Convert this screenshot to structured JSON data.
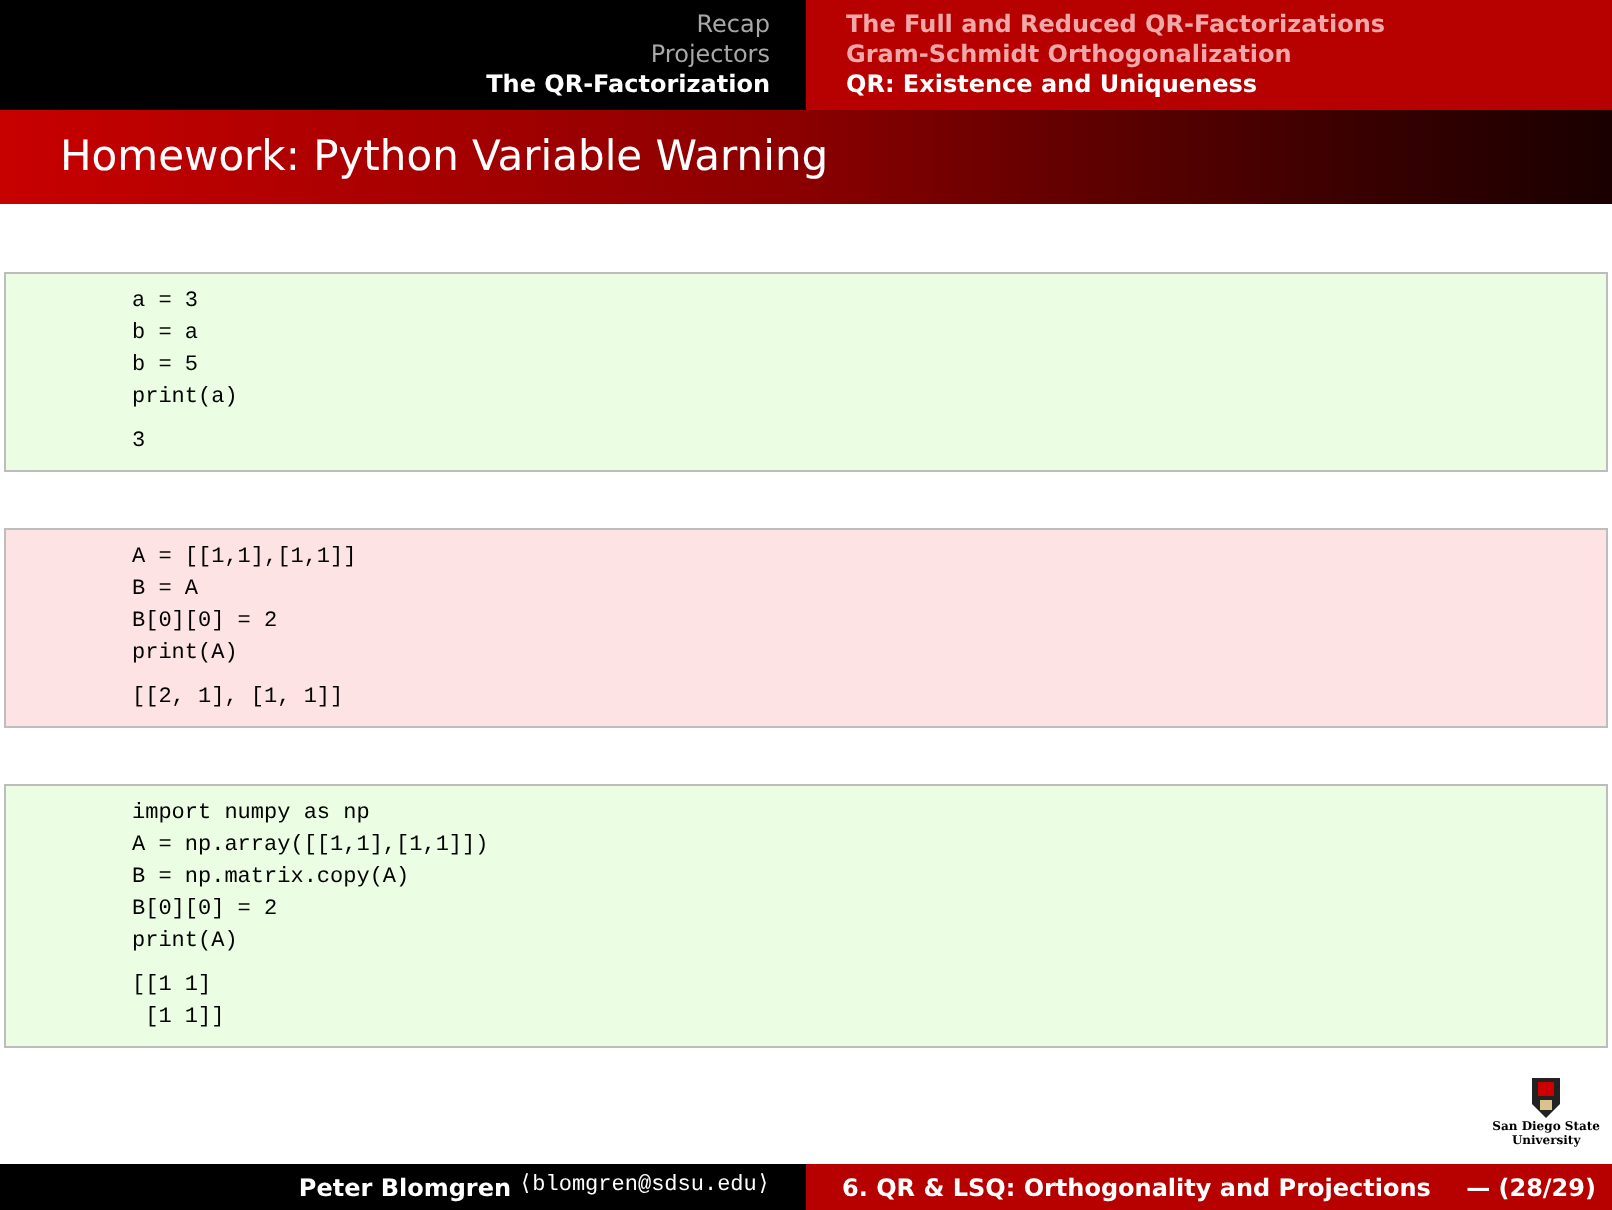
{
  "header": {
    "sections": [
      {
        "label": "Recap",
        "selected": false
      },
      {
        "label": "Projectors",
        "selected": false
      },
      {
        "label": "The QR-Factorization",
        "selected": true
      }
    ],
    "subsections": [
      {
        "label": "The Full and Reduced QR-Factorizations",
        "selected": false
      },
      {
        "label": "Gram-Schmidt Orthogonalization",
        "selected": false
      },
      {
        "label": "QR: Existence and Uniqueness",
        "selected": true
      }
    ]
  },
  "slide_title": "Homework: Python Variable Warning",
  "code_blocks": [
    {
      "kind": "ok",
      "code": [
        "a = 3",
        "b = a",
        "b = 5",
        "print(a)"
      ],
      "output": [
        "3"
      ]
    },
    {
      "kind": "warning",
      "code": [
        "A = [[1,1],[1,1]]",
        "B = A",
        "B[0][0] = 2",
        "print(A)"
      ],
      "output": [
        "[[2, 1], [1, 1]]"
      ]
    },
    {
      "kind": "ok",
      "code": [
        "import numpy as np",
        "A = np.array([[1,1],[1,1]])",
        "B = np.matrix.copy(A)",
        "B[0][0] = 2",
        "print(A)"
      ],
      "output": [
        "[[1 1]",
        " [1 1]]"
      ]
    }
  ],
  "logo": {
    "lines": [
      "San Diego State",
      "University"
    ]
  },
  "footer": {
    "author": "Peter Blomgren",
    "email": "⟨blomgren@sdsu.edu⟩",
    "talk": "6. QR & LSQ: Orthogonality and Projections",
    "page": "— (28/29)"
  }
}
